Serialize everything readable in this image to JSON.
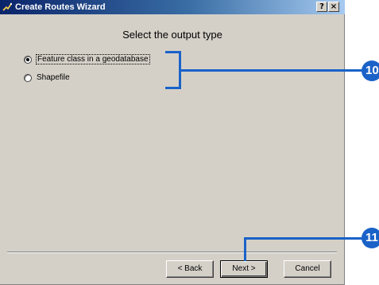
{
  "window": {
    "title": "Create Routes Wizard",
    "help_button": "?",
    "close_button": "×"
  },
  "heading": "Select the output type",
  "output_types": [
    {
      "label": "Feature class in a geodatabase",
      "selected": true
    },
    {
      "label": "Shapefile",
      "selected": false
    }
  ],
  "buttons": {
    "back": "< Back",
    "next": "Next >",
    "cancel": "Cancel"
  },
  "callouts": [
    {
      "number": "10",
      "color": "#1a62c8"
    },
    {
      "number": "11",
      "color": "#1a62c8"
    }
  ],
  "colors": {
    "dialog_face": "#d4d0c8",
    "titlebar_start": "#0a246a",
    "callout": "#1a62c8"
  }
}
